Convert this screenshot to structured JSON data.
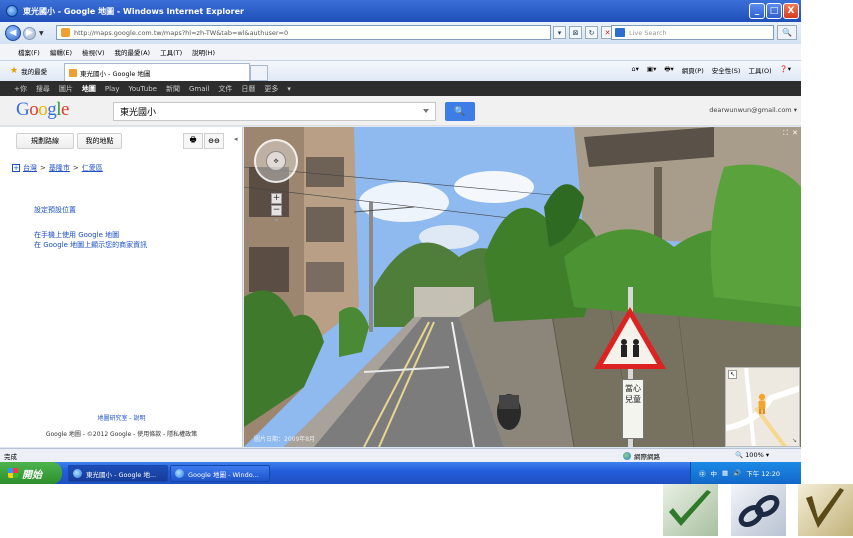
{
  "window": {
    "title": "東光國小 - Google 地圖 - Windows Internet Explorer",
    "buttons": [
      "_",
      "□",
      "X"
    ]
  },
  "address": {
    "url": "http://maps.google.com.tw/maps?hl=zh-TW&tab=wl&authuser=0",
    "search_placeholder": "Live Search"
  },
  "menu": [
    "檔案(F)",
    "編輯(E)",
    "檢視(V)",
    "我的最愛(A)",
    "工具(T)",
    "說明(H)"
  ],
  "favorites": {
    "label": "我的最愛",
    "tab_title": "東光國小 - Google 地圖",
    "commands": [
      "網頁(P)",
      "安全性(S)",
      "工具(O)"
    ]
  },
  "gbar": {
    "items": [
      "+你",
      "搜尋",
      "圖片",
      "地圖",
      "Play",
      "YouTube",
      "新聞",
      "Gmail",
      "文件",
      "日曆",
      "更多"
    ],
    "active": "地圖"
  },
  "gheader": {
    "logo": "Google",
    "query": "東光國小",
    "search_button": "🔍",
    "account": "dearwunwun@gmail.com"
  },
  "leftpanel": {
    "directions_button": "規劃路線",
    "my_places_button": "我的地點",
    "print_icon": "🖶",
    "link_icon": "⊖⊖",
    "breadcrumb": [
      "台灣",
      "基隆市",
      "仁愛區"
    ],
    "default_location": "設定預設位置",
    "mobile_link": "在手機上使用 Google 地圖",
    "business_link": "在 Google 地圖上顯示您的商家資訊",
    "footer_links": "地圖研究室 - 說明",
    "footer": "Google 地圖 - ©2012 Google - 使用條款 - 隱私權政策"
  },
  "streetview": {
    "copyright": "圖片日期：2009年8月",
    "sign_text": "當心兒童",
    "corner_icons": [
      "⛶",
      "✕"
    ]
  },
  "status": {
    "done": "完成",
    "zone": "網際網路",
    "zoom": "100%"
  },
  "taskbar": {
    "start": "開始",
    "tasks": [
      "東光國小 - Google 地...",
      "Google 地圖 - Windo..."
    ],
    "tray_text": "中",
    "clock": "下午 12:20"
  }
}
